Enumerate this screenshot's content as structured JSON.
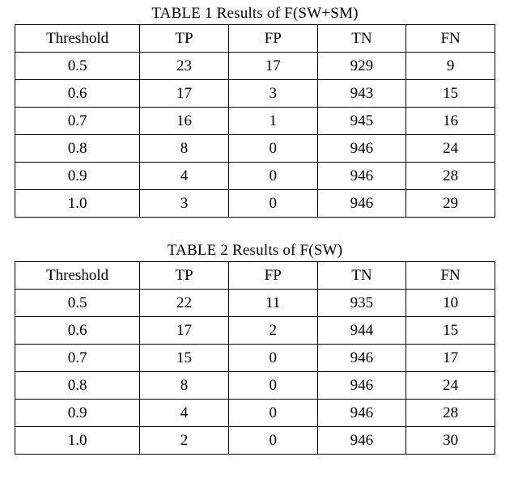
{
  "tables": [
    {
      "caption": "TABLE 1 Results of F(SW+SM)",
      "headers": [
        "Threshold",
        "TP",
        "FP",
        "TN",
        "FN"
      ],
      "rows": [
        [
          "0.5",
          "23",
          "17",
          "929",
          "9"
        ],
        [
          "0.6",
          "17",
          "3",
          "943",
          "15"
        ],
        [
          "0.7",
          "16",
          "1",
          "945",
          "16"
        ],
        [
          "0.8",
          "8",
          "0",
          "946",
          "24"
        ],
        [
          "0.9",
          "4",
          "0",
          "946",
          "28"
        ],
        [
          "1.0",
          "3",
          "0",
          "946",
          "29"
        ]
      ]
    },
    {
      "caption": "TABLE 2 Results of F(SW)",
      "headers": [
        "Threshold",
        "TP",
        "FP",
        "TN",
        "FN"
      ],
      "rows": [
        [
          "0.5",
          "22",
          "11",
          "935",
          "10"
        ],
        [
          "0.6",
          "17",
          "2",
          "944",
          "15"
        ],
        [
          "0.7",
          "15",
          "0",
          "946",
          "17"
        ],
        [
          "0.8",
          "8",
          "0",
          "946",
          "24"
        ],
        [
          "0.9",
          "4",
          "0",
          "946",
          "28"
        ],
        [
          "1.0",
          "2",
          "0",
          "946",
          "30"
        ]
      ]
    }
  ],
  "chart_data": [
    {
      "type": "table",
      "title": "TABLE 1 Results of F(SW+SM)",
      "columns": [
        "Threshold",
        "TP",
        "FP",
        "TN",
        "FN"
      ],
      "data": [
        {
          "Threshold": 0.5,
          "TP": 23,
          "FP": 17,
          "TN": 929,
          "FN": 9
        },
        {
          "Threshold": 0.6,
          "TP": 17,
          "FP": 3,
          "TN": 943,
          "FN": 15
        },
        {
          "Threshold": 0.7,
          "TP": 16,
          "FP": 1,
          "TN": 945,
          "FN": 16
        },
        {
          "Threshold": 0.8,
          "TP": 8,
          "FP": 0,
          "TN": 946,
          "FN": 24
        },
        {
          "Threshold": 0.9,
          "TP": 4,
          "FP": 0,
          "TN": 946,
          "FN": 28
        },
        {
          "Threshold": 1.0,
          "TP": 3,
          "FP": 0,
          "TN": 946,
          "FN": 29
        }
      ]
    },
    {
      "type": "table",
      "title": "TABLE 2 Results of F(SW)",
      "columns": [
        "Threshold",
        "TP",
        "FP",
        "TN",
        "FN"
      ],
      "data": [
        {
          "Threshold": 0.5,
          "TP": 22,
          "FP": 11,
          "TN": 935,
          "FN": 10
        },
        {
          "Threshold": 0.6,
          "TP": 17,
          "FP": 2,
          "TN": 944,
          "FN": 15
        },
        {
          "Threshold": 0.7,
          "TP": 15,
          "FP": 0,
          "TN": 946,
          "FN": 17
        },
        {
          "Threshold": 0.8,
          "TP": 8,
          "FP": 0,
          "TN": 946,
          "FN": 24
        },
        {
          "Threshold": 0.9,
          "TP": 4,
          "FP": 0,
          "TN": 946,
          "FN": 28
        },
        {
          "Threshold": 1.0,
          "TP": 2,
          "FP": 0,
          "TN": 946,
          "FN": 30
        }
      ]
    }
  ]
}
